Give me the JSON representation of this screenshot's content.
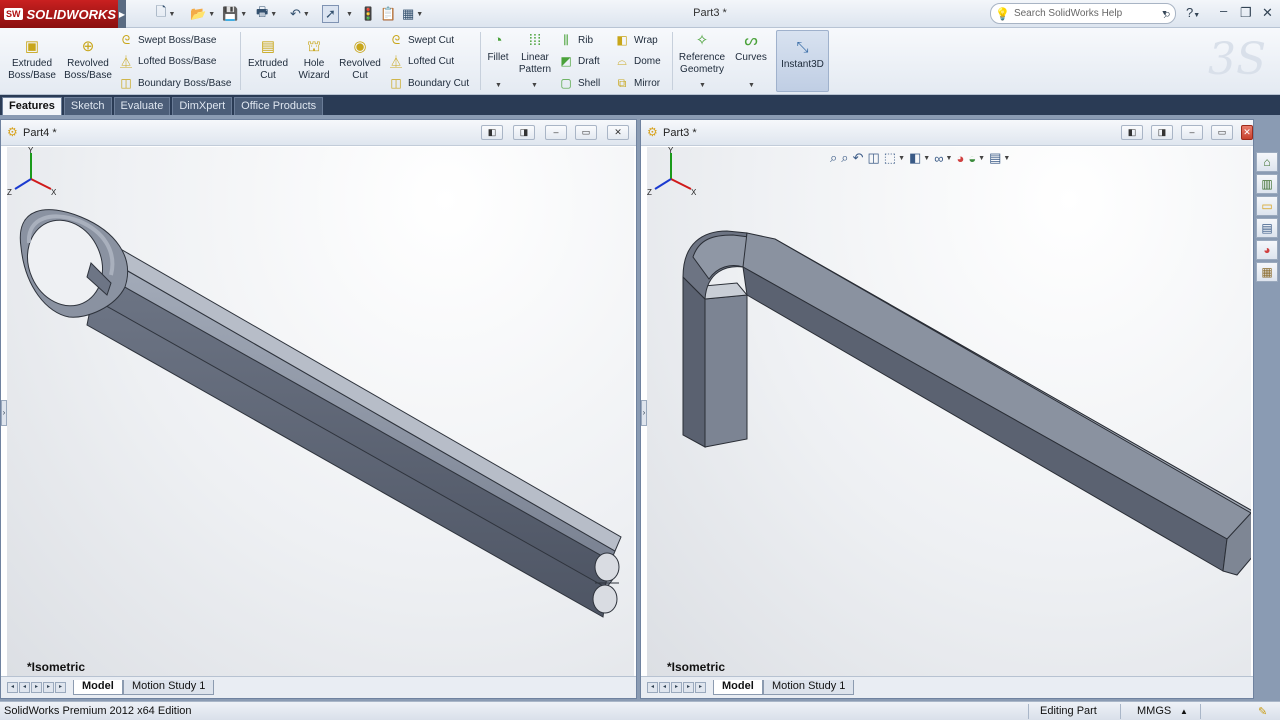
{
  "app": {
    "brand": "SOLIDWORKS",
    "brand_badge": "SW",
    "document_title": "Part3 *",
    "search_placeholder": "Search SolidWorks Help"
  },
  "quick_access": [
    "new-document-icon",
    "open-folder-icon",
    "save-icon",
    "print-icon",
    "undo-icon",
    "select-pointer-icon",
    "rebuild-icon",
    "file-properties-icon"
  ],
  "ribbon": {
    "extruded_boss": "Extruded Boss/Base",
    "revolved_boss": "Revolved Boss/Base",
    "swept_boss": "Swept Boss/Base",
    "lofted_boss": "Lofted Boss/Base",
    "boundary_boss": "Boundary Boss/Base",
    "extruded_cut": "Extruded Cut",
    "hole_wizard": "Hole Wizard",
    "revolved_cut": "Revolved Cut",
    "swept_cut": "Swept Cut",
    "lofted_cut": "Lofted Cut",
    "boundary_cut": "Boundary Cut",
    "fillet": "Fillet",
    "linear_pattern": "Linear Pattern",
    "rib": "Rib",
    "draft": "Draft",
    "shell": "Shell",
    "wrap": "Wrap",
    "dome": "Dome",
    "mirror": "Mirror",
    "reference_geometry": "Reference Geometry",
    "curves": "Curves",
    "instant3d": "Instant3D"
  },
  "tabs": [
    {
      "label": "Features",
      "active": true
    },
    {
      "label": "Sketch",
      "active": false
    },
    {
      "label": "Evaluate",
      "active": false
    },
    {
      "label": "DimXpert",
      "active": false
    },
    {
      "label": "Office Products",
      "active": false
    }
  ],
  "windows": {
    "left": {
      "title": "Part4 *",
      "view_label": "*Isometric",
      "tab_model": "Model",
      "tab_motion": "Motion Study 1"
    },
    "right": {
      "title": "Part3 *",
      "view_label": "*Isometric",
      "tab_model": "Model",
      "tab_motion": "Motion Study 1"
    }
  },
  "triad": {
    "x": "X",
    "y": "Y",
    "z": "Z"
  },
  "heads_up_icons": [
    "zoom-to-fit-icon",
    "zoom-area-icon",
    "previous-view-icon",
    "section-view-icon",
    "view-orientation-icon",
    "display-style-icon",
    "hide-show-icon",
    "appearance-icon",
    "scene-icon",
    "view-settings-icon"
  ],
  "task_pane_icons": [
    "resources-icon",
    "design-library-icon",
    "file-explorer-icon",
    "view-palette-icon",
    "appearances-icon",
    "custom-properties-icon"
  ],
  "statusbar": {
    "edition": "SolidWorks Premium 2012 x64 Edition",
    "mode": "Editing Part",
    "units": "MMGS"
  },
  "colors": {
    "brand_red": "#c92020",
    "model_gray": "#7d8594",
    "tab_bar": "#2a3b55"
  }
}
